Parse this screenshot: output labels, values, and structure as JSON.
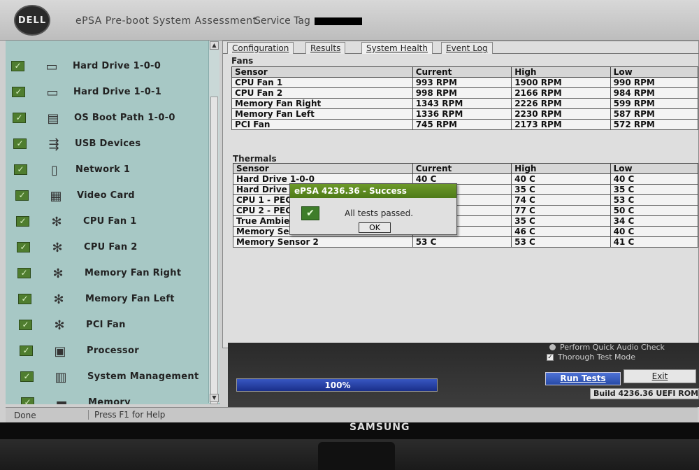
{
  "header": {
    "logo": "DELL",
    "title": "ePSA Pre-boot System Assessment",
    "service_tag_label": "Service Tag"
  },
  "devices": [
    {
      "label": "Hard Drive 1-0-0",
      "icon": "hard-drive-icon",
      "glyph": "▭"
    },
    {
      "label": "Hard Drive 1-0-1",
      "icon": "hard-drive-icon",
      "glyph": "▭"
    },
    {
      "label": "OS Boot Path 1-0-0",
      "icon": "boot-path-icon",
      "glyph": "▤"
    },
    {
      "label": "USB Devices",
      "icon": "usb-icon",
      "glyph": "⇶"
    },
    {
      "label": "Network 1",
      "icon": "network-icon",
      "glyph": "▯"
    },
    {
      "label": "Video Card",
      "icon": "video-card-icon",
      "glyph": "▦"
    },
    {
      "label": "CPU Fan 1",
      "icon": "fan-icon",
      "glyph": "✻"
    },
    {
      "label": "CPU Fan 2",
      "icon": "fan-icon",
      "glyph": "✻"
    },
    {
      "label": "Memory Fan Right",
      "icon": "fan-icon",
      "glyph": "✻"
    },
    {
      "label": "Memory Fan Left",
      "icon": "fan-icon",
      "glyph": "✻"
    },
    {
      "label": "PCI Fan",
      "icon": "fan-icon",
      "glyph": "✻"
    },
    {
      "label": "Processor",
      "icon": "processor-icon",
      "glyph": "▣"
    },
    {
      "label": "System Management",
      "icon": "system-management-icon",
      "glyph": "▥"
    },
    {
      "label": "Memory",
      "icon": "memory-icon",
      "glyph": "▬"
    }
  ],
  "tabs": [
    {
      "label": "Configuration"
    },
    {
      "label": "Results"
    },
    {
      "label": "System Health"
    },
    {
      "label": "Event Log"
    }
  ],
  "fans": {
    "title": "Fans",
    "headers": [
      "Sensor",
      "Current",
      "High",
      "Low"
    ],
    "rows": [
      [
        "CPU Fan 1",
        "993 RPM",
        "1900 RPM",
        "990 RPM"
      ],
      [
        "CPU Fan 2",
        "998 RPM",
        "2166 RPM",
        "984 RPM"
      ],
      [
        "Memory Fan Right",
        "1343 RPM",
        "2226 RPM",
        "599 RPM"
      ],
      [
        "Memory Fan Left",
        "1336 RPM",
        "2230 RPM",
        "587 RPM"
      ],
      [
        "PCI Fan",
        "745 RPM",
        "2173 RPM",
        "572 RPM"
      ]
    ]
  },
  "thermals": {
    "title": "Thermals",
    "headers": [
      "Sensor",
      "Current",
      "High",
      "Low"
    ],
    "rows": [
      [
        "Hard Drive 1-0-0",
        "40 C",
        "40 C",
        "40 C"
      ],
      [
        "Hard Drive",
        "",
        "35 C",
        "35 C"
      ],
      [
        "CPU 1 - PEC",
        "",
        "74 C",
        "53 C"
      ],
      [
        "CPU 2 - PEC",
        "",
        "77 C",
        "50 C"
      ],
      [
        "True Ambie",
        "",
        "35 C",
        "34 C"
      ],
      [
        "Memory Se",
        "",
        "46 C",
        "40 C"
      ],
      [
        "Memory Sensor 2",
        "53 C",
        "53 C",
        "41 C"
      ]
    ]
  },
  "dialog": {
    "title": "ePSA 4236.36 - Success",
    "message": "All tests passed.",
    "ok_label": "OK"
  },
  "progress": {
    "value": 100,
    "label": "100%"
  },
  "options": {
    "audio_check": "Perform Quick Audio Check",
    "thorough": "Thorough Test Mode"
  },
  "buttons": {
    "run": "Run Tests",
    "exit": "Exit"
  },
  "build": "Build  4236.36 UEFI ROM",
  "status": {
    "done": "Done",
    "help": "Press F1 for Help"
  },
  "monitor_brand": "SAMSUNG"
}
